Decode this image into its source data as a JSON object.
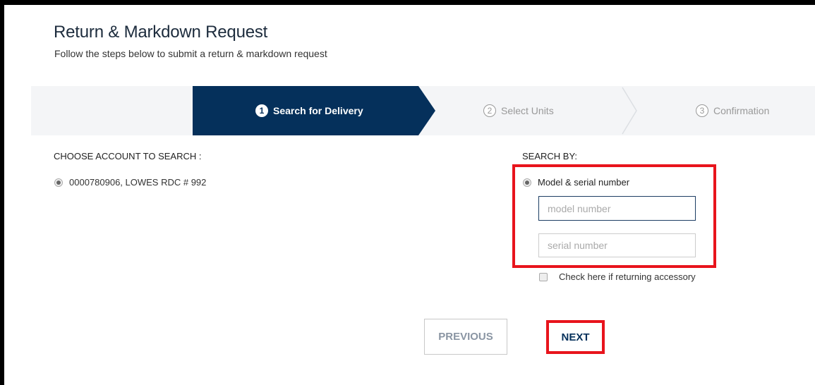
{
  "header": {
    "title": "Return & Markdown Request",
    "subtitle": "Follow the steps below to submit a return & markdown request"
  },
  "stepper": {
    "steps": [
      {
        "number": "1",
        "label": "Search for Delivery",
        "state": "active"
      },
      {
        "number": "2",
        "label": "Select Units",
        "state": "inactive"
      },
      {
        "number": "3",
        "label": "Confirmation",
        "state": "inactive"
      }
    ]
  },
  "account": {
    "label": "CHOOSE ACCOUNT TO SEARCH :",
    "selected": "0000780906, LOWES RDC # 992"
  },
  "search": {
    "label": "SEARCH BY:",
    "option": "Model & serial number",
    "model_placeholder": "model number",
    "serial_placeholder": "serial number",
    "accessory_label": "Check here if returning accessory"
  },
  "actions": {
    "previous": "PREVIOUS",
    "next": "NEXT"
  },
  "colors": {
    "accent": "#05305b",
    "highlight": "#e8141c"
  }
}
